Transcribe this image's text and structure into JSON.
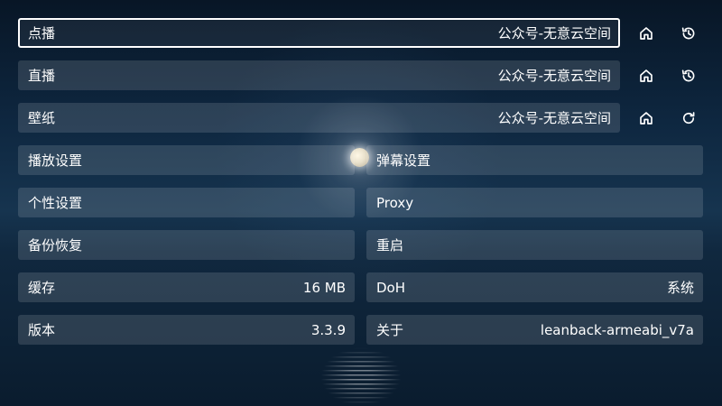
{
  "rows": {
    "vod": {
      "label": "点播",
      "value": "公众号-无意云空间"
    },
    "live": {
      "label": "直播",
      "value": "公众号-无意云空间"
    },
    "wallpaper": {
      "label": "壁纸",
      "value": "公众号-无意云空间"
    }
  },
  "settings": {
    "playback": {
      "label": "播放设置"
    },
    "danmaku": {
      "label": "弹幕设置"
    },
    "personal": {
      "label": "个性设置"
    },
    "proxy": {
      "label": "Proxy"
    },
    "backup": {
      "label": "备份恢复"
    },
    "restart": {
      "label": "重启"
    },
    "cache": {
      "label": "缓存",
      "value": "16 MB"
    },
    "doh": {
      "label": "DoH",
      "value": "系统"
    },
    "version": {
      "label": "版本",
      "value": "3.3.9"
    },
    "about": {
      "label": "关于",
      "value": "leanback-armeabi_v7a"
    }
  },
  "icons": {
    "home": "home-icon",
    "history": "history-icon",
    "refresh": "refresh-icon"
  },
  "colors": {
    "row_background": "rgba(255,255,255,0.13)",
    "focus_border": "#ffffff",
    "text": "#ffffff"
  }
}
